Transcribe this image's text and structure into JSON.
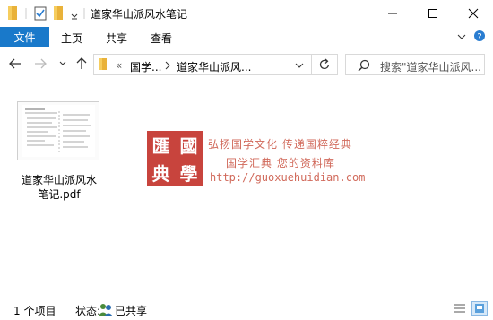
{
  "window": {
    "title": "道家华山派风水笔记"
  },
  "ribbon": {
    "tabs": [
      "文件",
      "主页",
      "共享",
      "查看"
    ]
  },
  "address": {
    "crumbs": [
      "«",
      "国学...",
      "道家华山派风..."
    ]
  },
  "search": {
    "placeholder": "搜索\"道家华山派风..."
  },
  "file": {
    "name_line1": "道家华山派风水",
    "name_line2": "笔记.pdf"
  },
  "watermark": {
    "seal": [
      "匯",
      "國",
      "典",
      "學"
    ],
    "line1": "弘扬国学文化  传递国粹经典",
    "line2": "国学汇典  您的资料库",
    "url": "http://guoxuehuidian.com"
  },
  "status": {
    "count": "1 个项目",
    "state_label": "状态:",
    "state_value": "已共享"
  },
  "colors": {
    "accent": "#1979ca",
    "watermark": "#c8443d"
  }
}
